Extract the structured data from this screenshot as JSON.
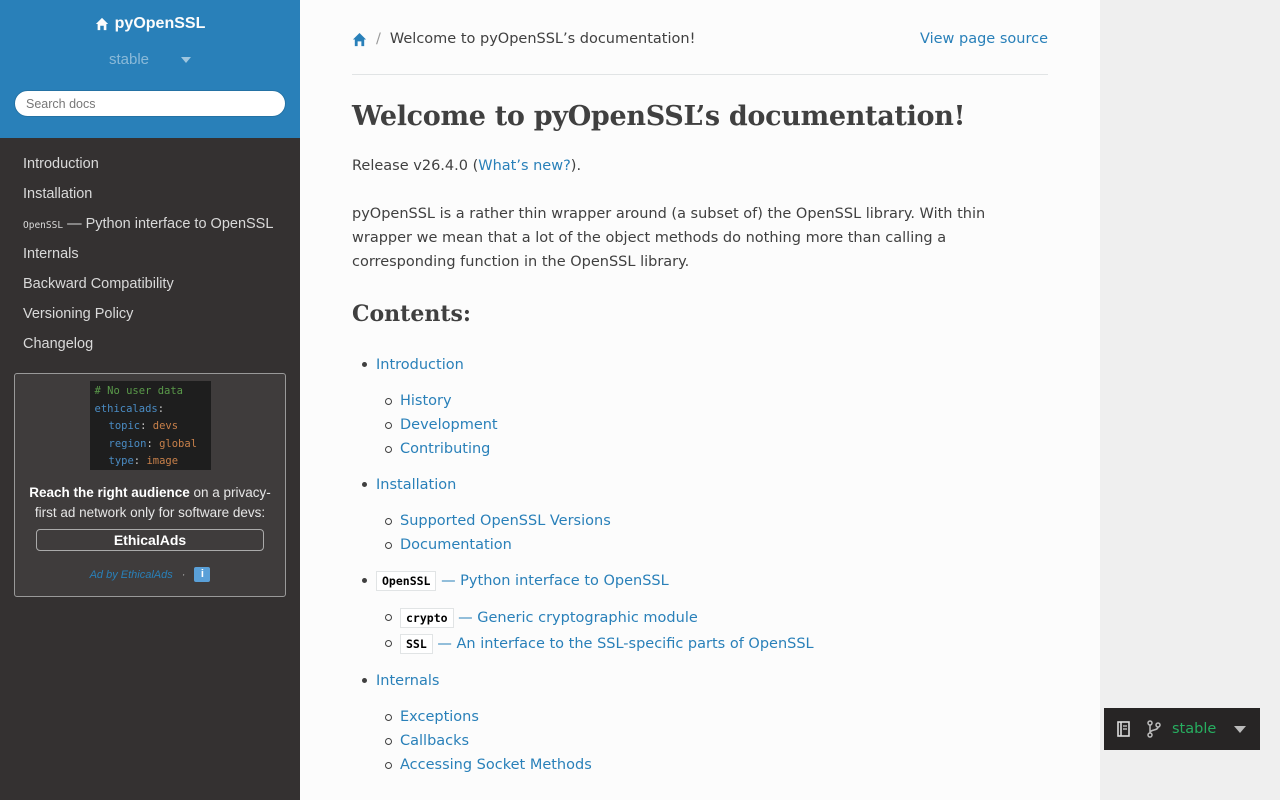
{
  "sidebar": {
    "project_name": "pyOpenSSL",
    "version": "stable",
    "search_placeholder": "Search docs",
    "nav": [
      {
        "label": "Introduction"
      },
      {
        "label": "Installation"
      },
      {
        "code": "OpenSSL",
        "label": " — Python interface to OpenSSL"
      },
      {
        "label": "Internals"
      },
      {
        "label": "Backward Compatibility"
      },
      {
        "label": "Versioning Policy"
      },
      {
        "label": "Changelog"
      }
    ],
    "ad": {
      "code_lines": [
        "# No user data",
        "ethicalads:",
        "topic: devs",
        "region: global",
        "type: image"
      ],
      "code_comment": "# No user data",
      "code_key": "ethicalads",
      "code_topic_key": "topic",
      "code_topic_val": "devs",
      "code_region_key": "region",
      "code_region_val": "global",
      "code_type_key": "type",
      "code_type_val": "image",
      "text_bold": "Reach the right audience",
      "text_rest": " on a privacy-first ad network only for software devs:",
      "button": "EthicalAds",
      "by": "Ad by EthicalAds",
      "dot": "·",
      "info": "i"
    }
  },
  "breadcrumb": {
    "current": "Welcome to pyOpenSSL’s documentation!",
    "sep": "/",
    "view_source": "View page source"
  },
  "main": {
    "title": "Welcome to pyOpenSSL’s documentation!",
    "release_prefix": "Release v26.4.0 (",
    "release_link": "What’s new?",
    "release_suffix": ").",
    "intro": "pyOpenSSL is a rather thin wrapper around (a subset of) the OpenSSL library. With thin wrapper we mean that a lot of the object methods do nothing more than calling a corresponding function in the OpenSSL library.",
    "contents_heading": "Contents:",
    "toc": {
      "intro": {
        "label": "Introduction",
        "children": [
          "History",
          "Development",
          "Contributing"
        ]
      },
      "install": {
        "label": "Installation",
        "children": [
          "Supported OpenSSL Versions",
          "Documentation"
        ]
      },
      "openssl": {
        "code": "OpenSSL",
        "label": " — Python interface to OpenSSL",
        "children": [
          {
            "code": "crypto",
            "label": " — Generic cryptographic module"
          },
          {
            "code": "SSL",
            "label": " — An interface to the SSL-specific parts of OpenSSL"
          }
        ]
      },
      "internals": {
        "label": "Internals",
        "children": [
          "Exceptions",
          "Callbacks",
          "Accessing Socket Methods"
        ]
      }
    }
  },
  "version_badge": {
    "label": "stable",
    "color": "#27ae60"
  },
  "colors": {
    "sidebar_top": "#2980b9",
    "sidebar_bg": "#343131",
    "link": "#2980b9",
    "text": "#404040"
  }
}
